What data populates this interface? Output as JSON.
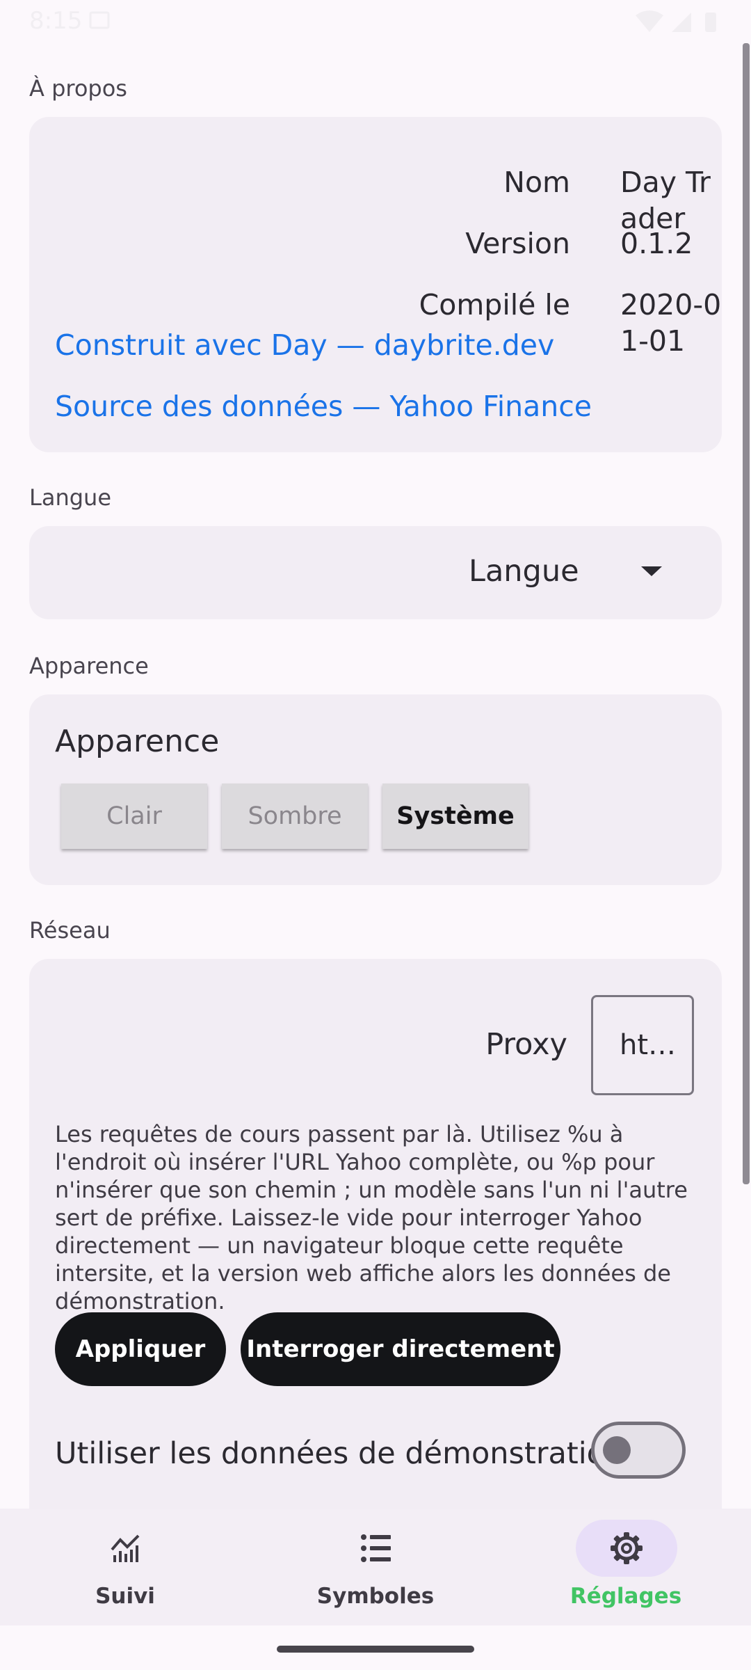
{
  "status_bar": {
    "time": "8:15"
  },
  "about": {
    "section_label": "À propos",
    "rows": [
      {
        "label": "Nom",
        "value": "Day Trader"
      },
      {
        "label": "Version",
        "value": "0.1.2"
      },
      {
        "label": "Compilé le",
        "value": "2020-01-01"
      }
    ],
    "links": [
      {
        "text": "Construit avec Day — daybrite.dev"
      },
      {
        "text": "Source des données — Yahoo Finance"
      }
    ],
    "link_color": "#1a73e8"
  },
  "language": {
    "section_label": "Langue",
    "selected": "Langue"
  },
  "appearance": {
    "section_label": "Apparence",
    "title": "Apparence",
    "options": [
      "Clair",
      "Sombre",
      "Système"
    ],
    "selected": "Système"
  },
  "network": {
    "section_label": "Réseau",
    "proxy_label": "Proxy",
    "proxy_value_visible": "ht…",
    "help_text": "Les requêtes de cours passent par là. Utilisez %u à l'endroit où insérer l'URL Yahoo complète, ou %p pour n'insérer que son chemin ; un modèle sans l'un ni l'autre sert de préfixe. Laissez-le vide pour interroger Yahoo directement — un navigateur bloque cette requête intersite, et la version web affiche alors les données de démonstration.",
    "apply_label": "Appliquer",
    "direct_label": "Interroger directement",
    "demo_label": "Utiliser les données de démonstration",
    "demo_enabled": false
  },
  "bottom_nav": {
    "items": [
      {
        "label": "Suivi",
        "icon": "chart-icon",
        "active": false
      },
      {
        "label": "Symboles",
        "icon": "list-icon",
        "active": false
      },
      {
        "label": "Réglages",
        "icon": "gear-icon",
        "active": true
      }
    ],
    "active_color": "#41c464"
  }
}
